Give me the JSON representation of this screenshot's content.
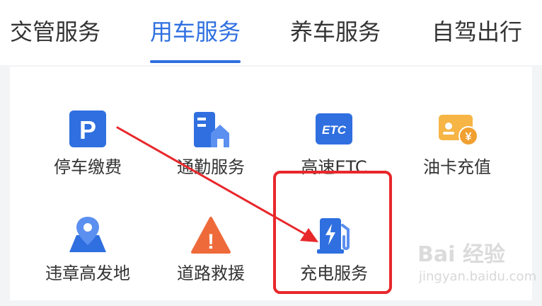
{
  "tabs": [
    {
      "label": "交管服务",
      "active": false
    },
    {
      "label": "用车服务",
      "active": true
    },
    {
      "label": "养车服务",
      "active": false
    },
    {
      "label": "自驾出行",
      "active": false
    }
  ],
  "services": [
    {
      "label": "停车缴费",
      "icon": "parking-icon"
    },
    {
      "label": "通勤服务",
      "icon": "commute-building-icon"
    },
    {
      "label": "高速ETC",
      "icon": "etc-icon"
    },
    {
      "label": "油卡充值",
      "icon": "fuel-card-icon"
    },
    {
      "label": "违章高发地",
      "icon": "map-location-icon"
    },
    {
      "label": "道路救援",
      "icon": "warning-icon"
    },
    {
      "label": "充电服务",
      "icon": "charging-station-icon"
    }
  ],
  "icon_text": {
    "parking": "P",
    "etc": "ETC",
    "fuel_card": "¥",
    "warning": "!"
  },
  "watermark": {
    "logo": "Bai 经验",
    "url": "jingyan.baidu.com"
  },
  "colors": {
    "accent_blue": "#2f6fe0",
    "highlight_red": "#e8272b",
    "fuel_orange": "#f0a030",
    "warning_orange": "#ee6a3a"
  }
}
